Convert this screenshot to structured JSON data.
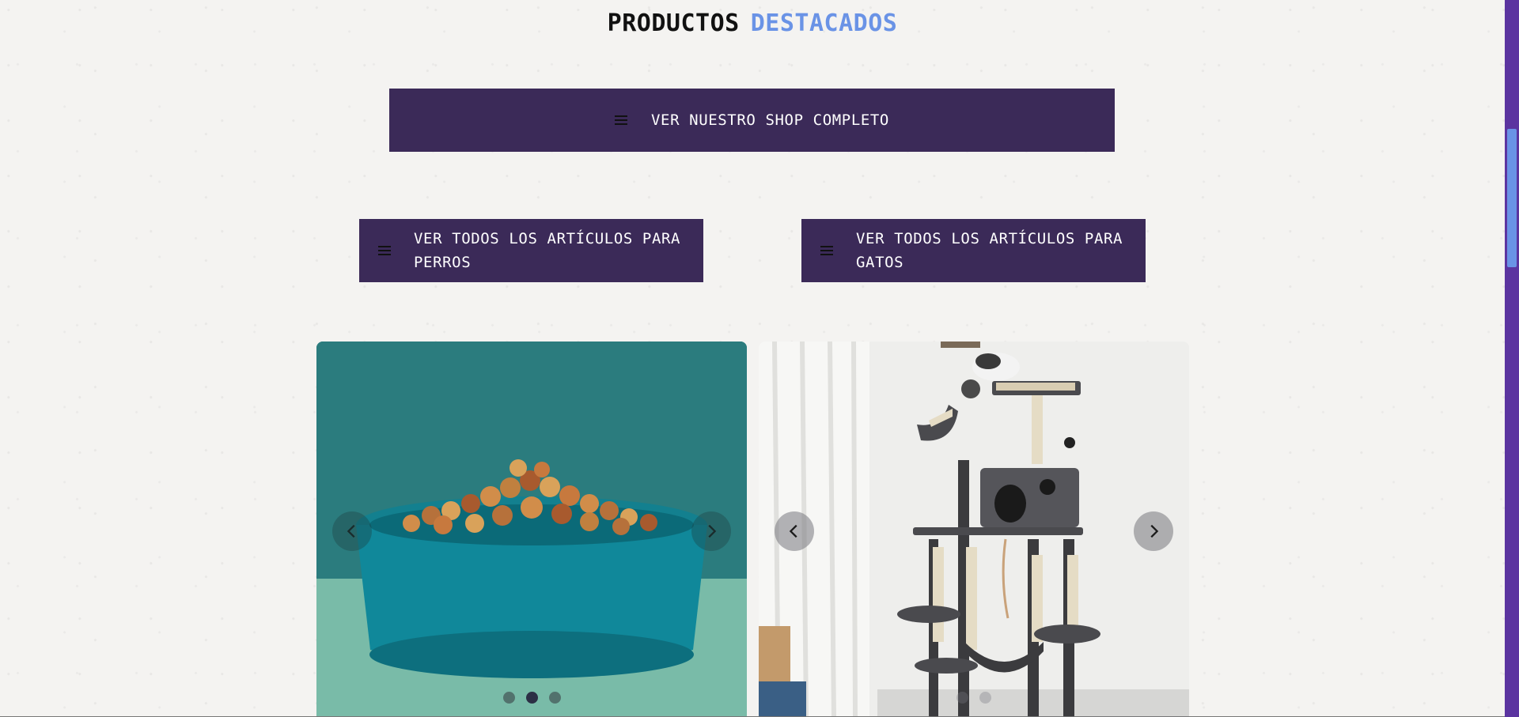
{
  "section": {
    "title_part1": "PRODUCTOS",
    "title_part2": "DESTACADOS"
  },
  "buttons": {
    "shop": "VER NUESTRO SHOP COMPLETO",
    "dogs": "VER TODOS LOS ARTÍCULOS PARA PERROS",
    "cats": "VER TODOS LOS ARTÍCULOS PARA GATOS"
  },
  "carousels": [
    {
      "name": "dog-food-bowl",
      "slides": 3,
      "active_slide": 2
    },
    {
      "name": "cat-tree",
      "slides": 2,
      "active_slide": 1
    }
  ],
  "colors": {
    "button_bg": "#3b2a58",
    "title_accent": "#6a93e6",
    "scrollbar": "#5b34a0"
  },
  "icons": {
    "menu": "hamburger-menu-icon",
    "prev": "chevron-left-icon",
    "next": "chevron-right-icon"
  }
}
